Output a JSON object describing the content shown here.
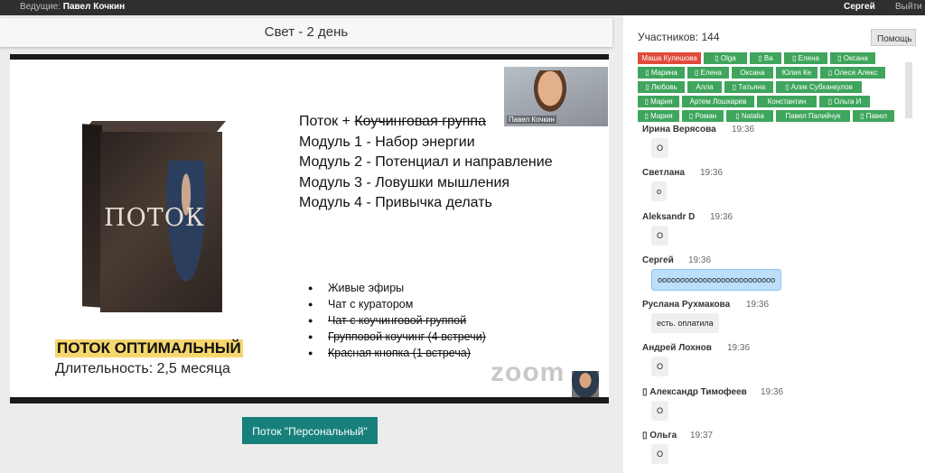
{
  "topbar": {
    "host_label": "Ведущие:",
    "host_name": "Павел Кочкин",
    "user": "Сергей",
    "logout": "Выйти"
  },
  "main": {
    "title": "Свет - 2 день",
    "cta_label": "Поток \"Персональный\""
  },
  "slide": {
    "box_title": "ПОТОК",
    "plan_title": "ПОТОК ОПТИМАЛЬНЫЙ",
    "plan_duration": "Длительность: 2,5 месяца",
    "heading_prefix": "Поток + ",
    "heading_struck": "Коучинговая группа",
    "modules": [
      "Модуль 1 - Набор энергии",
      "Модуль 2 - Потенциал и направление",
      "Модуль 3 - Ловушки мышления",
      "Модуль 4 - Привычка делать"
    ],
    "bullets": [
      {
        "text": "Живые эфиры",
        "struck": false
      },
      {
        "text": "Чат с куратором",
        "struck": false
      },
      {
        "text": "Чат с коучинговой группой",
        "struck": true
      },
      {
        "text": "Групповой коучинг (4 встречи)",
        "struck": true
      },
      {
        "text": "Красная кнопка (1 встреча)",
        "struck": true
      }
    ],
    "camera_name": "Павел Кочкин",
    "zoom_logo": "zoom"
  },
  "sidebar": {
    "participants_count": "Участников: 144",
    "help_label": "Помощь",
    "tags": [
      {
        "label": "Маша Кулешова",
        "color": "#e04b3a"
      },
      {
        "label": "▯ Olga",
        "color": "#3fa55d"
      },
      {
        "label": "▯ Ва",
        "color": "#3fa55d"
      },
      {
        "label": "▯ Елена",
        "color": "#3fa55d"
      },
      {
        "label": "▯ Оксана",
        "color": "#3fa55d"
      },
      {
        "label": "▯ Марина",
        "color": "#3fa55d"
      },
      {
        "label": "▯ Елена",
        "color": "#3fa55d"
      },
      {
        "label": "Оксана",
        "color": "#3fa55d"
      },
      {
        "label": "Юлия Ке",
        "color": "#3fa55d"
      },
      {
        "label": "▯ Олеся Алекс",
        "color": "#3fa55d"
      },
      {
        "label": "▯ Любовь",
        "color": "#3fa55d"
      },
      {
        "label": "Алла",
        "color": "#3fa55d"
      },
      {
        "label": "▯ Татьяна",
        "color": "#3fa55d"
      },
      {
        "label": "▯ Алик Субханкулов",
        "color": "#3fa55d"
      },
      {
        "label": "▯ Мария",
        "color": "#3fa55d"
      },
      {
        "label": "Артем Лошкарев",
        "color": "#3fa55d"
      },
      {
        "label": "Константин",
        "color": "#3fa55d"
      },
      {
        "label": "▯ Ольга И",
        "color": "#3fa55d"
      },
      {
        "label": "▯ Мария",
        "color": "#3fa55d"
      },
      {
        "label": "▯ Роман",
        "color": "#3fa55d"
      },
      {
        "label": "▯ Natalia",
        "color": "#3fa55d"
      },
      {
        "label": "Павел Палийчук",
        "color": "#3fa55d"
      },
      {
        "label": "▯ Павел",
        "color": "#3fa55d"
      }
    ],
    "messages": [
      {
        "name": "Ирина Верясова",
        "time": "19:36",
        "text": "О",
        "highlight": false
      },
      {
        "name": "Светлана",
        "time": "19:36",
        "text": "о",
        "highlight": false
      },
      {
        "name": "Aleksandr D",
        "time": "19:36",
        "text": "О",
        "highlight": false
      },
      {
        "name": "Сергей",
        "time": "19:36",
        "text": "оооооооооооооооооооооооооо",
        "highlight": true
      },
      {
        "name": "Руслана Рухмакова",
        "time": "19:36",
        "text": "есть. оплатила",
        "highlight": false
      },
      {
        "name": "Андрей Лохнов",
        "time": "19:36",
        "text": "О",
        "highlight": false
      },
      {
        "name": "▯ Александр Тимофеев",
        "time": "19:36",
        "text": "О",
        "highlight": false
      },
      {
        "name": "▯ Ольга",
        "time": "19:37",
        "text": "О",
        "highlight": false
      }
    ]
  }
}
